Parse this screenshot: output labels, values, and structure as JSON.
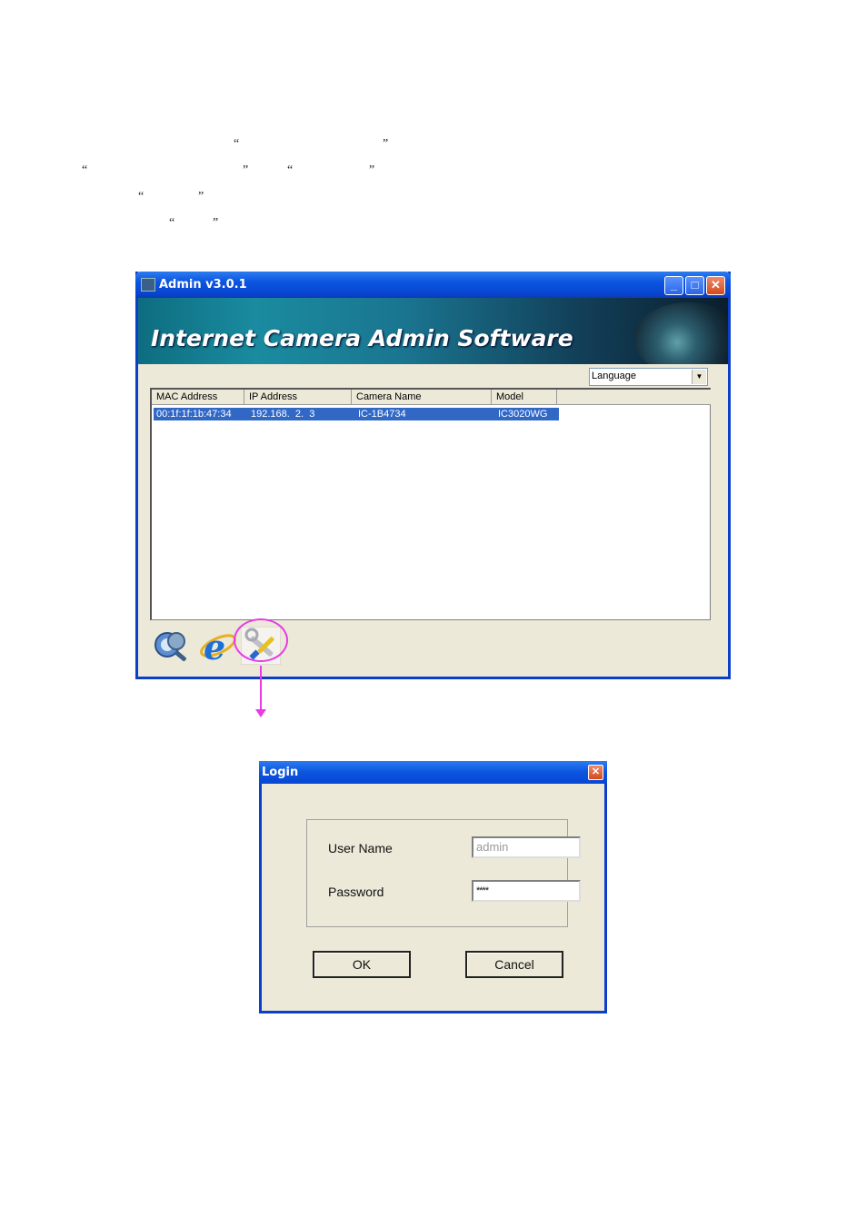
{
  "doc": {
    "quotes": [
      "“",
      "”",
      "“",
      "”",
      "“",
      "”",
      "“",
      "”",
      "“",
      "”"
    ]
  },
  "admin_window": {
    "title": "Admin v3.0.1",
    "banner_title": "Internet Camera Admin Software",
    "language_select": "Language",
    "columns": [
      "MAC Address",
      "IP Address",
      "Camera Name",
      "Model"
    ],
    "rows": [
      {
        "mac": "00:1f:1f:1b:47:34",
        "ip": "192.168.  2.  3",
        "name": "IC-1B4734",
        "model": "IC3020WG"
      }
    ],
    "toolbar": [
      "search-camera-icon",
      "internet-explorer-icon",
      "setup-tools-icon"
    ],
    "highlight_color": "#e83be6"
  },
  "login_dialog": {
    "title": "Login",
    "user_name_label": "User Name",
    "user_name_value": "admin",
    "password_label": "Password",
    "password_value": "****",
    "ok_label": "OK",
    "cancel_label": "Cancel"
  }
}
